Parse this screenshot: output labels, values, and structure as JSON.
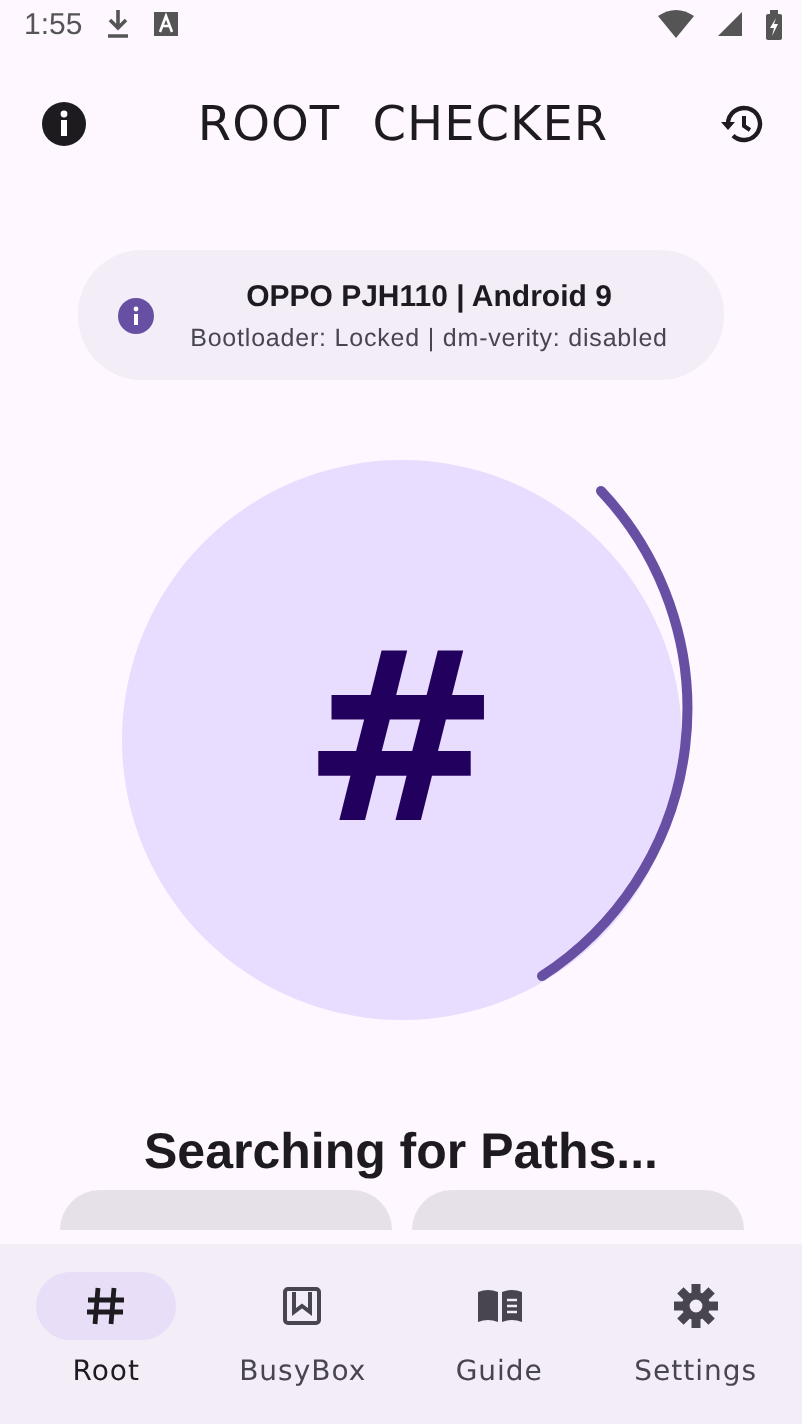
{
  "status_bar": {
    "time": "1:55"
  },
  "app_bar": {
    "title": "ROOT  CHECKER"
  },
  "device_card": {
    "title": "OPPO PJH110 | Android 9",
    "subtitle": "Bootloader: Locked | dm-verity: disabled"
  },
  "scan": {
    "symbol": "#",
    "status": "Searching for Paths..."
  },
  "nav": [
    {
      "label": "Root",
      "selected": true
    },
    {
      "label": "BusyBox",
      "selected": false
    },
    {
      "label": "Guide",
      "selected": false
    },
    {
      "label": "Settings",
      "selected": false
    }
  ]
}
